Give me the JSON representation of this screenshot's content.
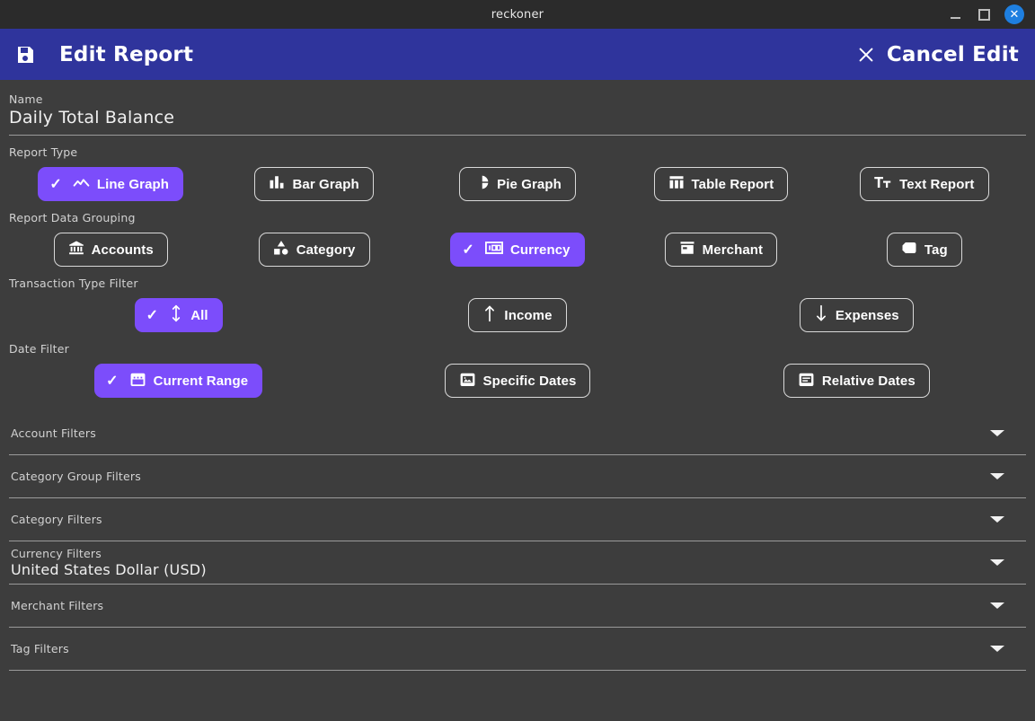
{
  "window": {
    "title": "reckoner",
    "controls": {
      "minimize": "minimize",
      "maximize": "maximize",
      "close": "✕"
    }
  },
  "header": {
    "save_icon": "save-icon",
    "title": "Edit Report",
    "cancel_icon": "✕",
    "cancel_label": "Cancel Edit",
    "accent_color": "#2f349c"
  },
  "name_field": {
    "label": "Name",
    "value": "Daily Total Balance"
  },
  "report_type": {
    "label": "Report Type",
    "options": [
      {
        "label": "Line Graph",
        "icon": "line-graph-icon",
        "selected": true
      },
      {
        "label": "Bar Graph",
        "icon": "bar-graph-icon",
        "selected": false
      },
      {
        "label": "Pie Graph",
        "icon": "pie-graph-icon",
        "selected": false
      },
      {
        "label": "Table Report",
        "icon": "table-report-icon",
        "selected": false
      },
      {
        "label": "Text Report",
        "icon": "text-report-icon",
        "selected": false
      }
    ]
  },
  "report_data_grouping": {
    "label": "Report Data Grouping",
    "options": [
      {
        "label": "Accounts",
        "icon": "bank-icon",
        "selected": false
      },
      {
        "label": "Category",
        "icon": "shapes-icon",
        "selected": false
      },
      {
        "label": "Currency",
        "icon": "banknote-icon",
        "selected": true
      },
      {
        "label": "Merchant",
        "icon": "store-icon",
        "selected": false
      },
      {
        "label": "Tag",
        "icon": "tag-icon",
        "selected": false
      }
    ]
  },
  "transaction_type_filter": {
    "label": "Transaction Type Filter",
    "options": [
      {
        "label": "All",
        "icon": "arrow-up-down-icon",
        "selected": true
      },
      {
        "label": "Income",
        "icon": "arrow-up-icon",
        "selected": false
      },
      {
        "label": "Expenses",
        "icon": "arrow-down-icon",
        "selected": false
      }
    ]
  },
  "date_filter": {
    "label": "Date Filter",
    "options": [
      {
        "label": "Current Range",
        "icon": "calendar-icon",
        "selected": true
      },
      {
        "label": "Specific Dates",
        "icon": "calendar-range-icon",
        "selected": false
      },
      {
        "label": "Relative Dates",
        "icon": "calendar-text-icon",
        "selected": false
      }
    ]
  },
  "filter_sections": [
    {
      "title": "Account Filters",
      "value": ""
    },
    {
      "title": "Category Group Filters",
      "value": ""
    },
    {
      "title": "Category Filters",
      "value": ""
    },
    {
      "title": "Currency Filters",
      "value": "United States Dollar (USD)"
    },
    {
      "title": "Merchant Filters",
      "value": ""
    },
    {
      "title": "Tag Filters",
      "value": ""
    }
  ],
  "theme": {
    "selected_chip": "#7c4dfb",
    "background": "#3d3d3d",
    "titlebar": "#2b2b2b",
    "close_button": "#1e7fe0"
  }
}
